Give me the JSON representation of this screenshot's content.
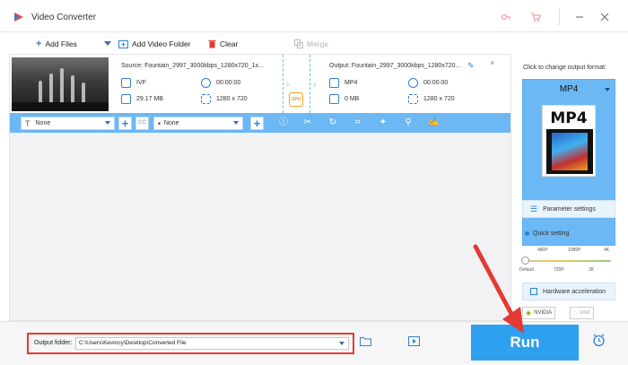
{
  "window": {
    "title": "Video Converter",
    "controls": [
      "key-icon",
      "cart-icon",
      "minimize-icon",
      "close-icon"
    ]
  },
  "toolbar": {
    "add_files": "Add Files",
    "add_video_folder": "Add Video Folder",
    "clear": "Clear",
    "merge": "Merge"
  },
  "file": {
    "source_title": "Source: Fountain_2997_3000kbps_1280x720_1x...",
    "output_title": "Output: Fountain_2997_3000kbps_1280x720...",
    "source": {
      "format": "IVF",
      "duration": "00:00:00",
      "size": "29.17 MB",
      "resolution": "1280 x 720"
    },
    "output": {
      "format": "MP4",
      "duration": "00:00:00",
      "size": "0 MB",
      "resolution": "1280 x 720"
    },
    "gpu_label": "GPU"
  },
  "edit_bar": {
    "subtitle_select": "None",
    "audio_select": "None",
    "cc_label": "CC"
  },
  "right_panel": {
    "hint": "Click to change output format:",
    "format": "MP4",
    "format_icon_label": "MP4",
    "parameter_settings": "Parameter settings",
    "quick_setting": "Quick setting",
    "ticks_top": [
      "480P",
      "1080P",
      "4K"
    ],
    "ticks_bottom": [
      "Default",
      "720P",
      "2K"
    ],
    "hardware_acceleration": "Hardware acceleration",
    "nvidia": "NVIDIA",
    "intel": "Intel"
  },
  "bottom": {
    "output_folder_label": "Output folder:",
    "output_folder_value": "C:\\Users\\Kevincy\\Desktop\\Converted File",
    "run": "Run"
  },
  "colors": {
    "accent": "#2ea0f0",
    "edit_bar": "#6cb8f4",
    "highlight": "#e53935"
  }
}
